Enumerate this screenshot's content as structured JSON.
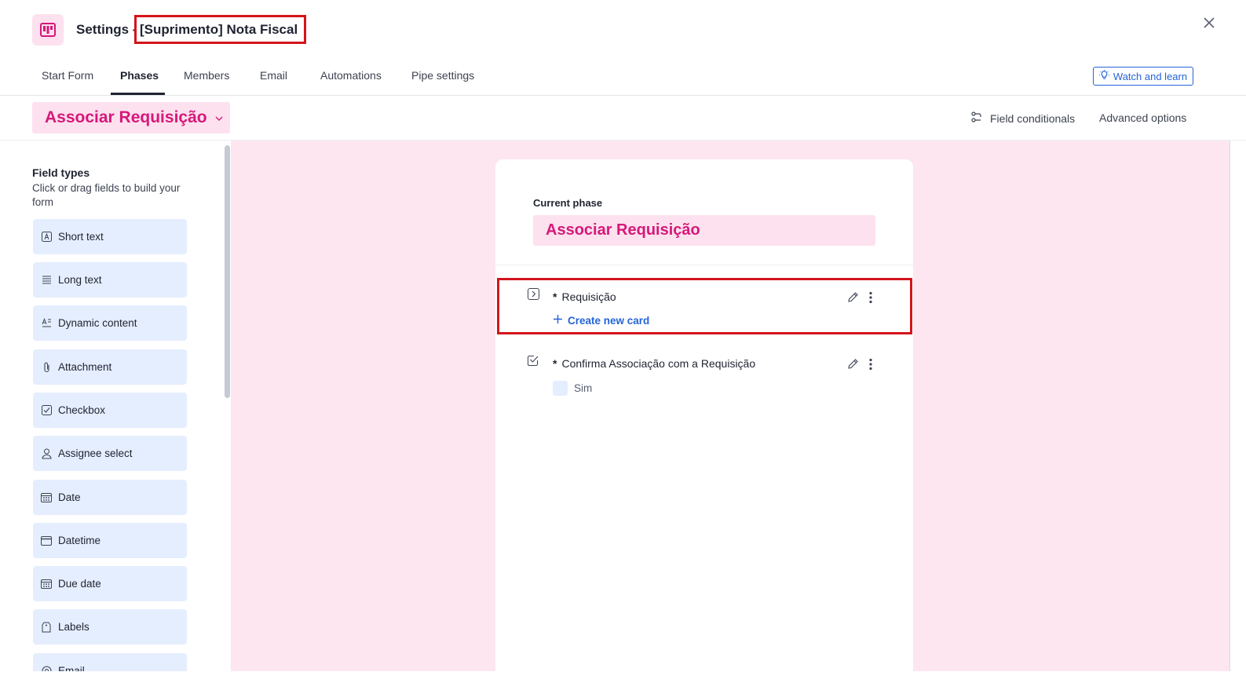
{
  "header": {
    "title_prefix": "Settings -",
    "pipe_name": "[Suprimento] Nota Fiscal"
  },
  "tabs": [
    {
      "label": "Start Form"
    },
    {
      "label": "Phases"
    },
    {
      "label": "Members"
    },
    {
      "label": "Email"
    },
    {
      "label": "Automations"
    },
    {
      "label": "Pipe settings"
    }
  ],
  "active_tab": "Phases",
  "watch_button": "Watch and learn",
  "phase_selector": {
    "selected": "Associar Requisição"
  },
  "toolbar": {
    "field_conditionals": "Field conditionals",
    "advanced_options": "Advanced options"
  },
  "sidebar": {
    "title": "Field types",
    "subtitle": "Click or drag fields to build your form",
    "items": [
      {
        "label": "Short text",
        "icon": "short-text-icon"
      },
      {
        "label": "Long text",
        "icon": "long-text-icon"
      },
      {
        "label": "Dynamic content",
        "icon": "dynamic-content-icon"
      },
      {
        "label": "Attachment",
        "icon": "paperclip-icon"
      },
      {
        "label": "Checkbox",
        "icon": "checkbox-icon"
      },
      {
        "label": "Assignee select",
        "icon": "user-icon"
      },
      {
        "label": "Date",
        "icon": "calendar-icon"
      },
      {
        "label": "Datetime",
        "icon": "datetime-icon"
      },
      {
        "label": "Due date",
        "icon": "calendar-icon"
      },
      {
        "label": "Labels",
        "icon": "tag-icon"
      },
      {
        "label": "Email",
        "icon": "at-icon"
      }
    ]
  },
  "form": {
    "current_phase_label": "Current phase",
    "current_phase_name": "Associar Requisição",
    "fields": [
      {
        "required_mark": "*",
        "label": "Requisição",
        "action": "Create new card"
      },
      {
        "required_mark": "*",
        "label": "Confirma Associação com a Requisição",
        "option": "Sim"
      }
    ]
  },
  "colors": {
    "accent_pink": "#d6187a",
    "pink_bg": "#fde1ee",
    "canvas_bg": "#fde6f0",
    "field_item_bg": "#e5eefe",
    "link_blue": "#2563d9",
    "highlight_red": "#d4141c"
  }
}
